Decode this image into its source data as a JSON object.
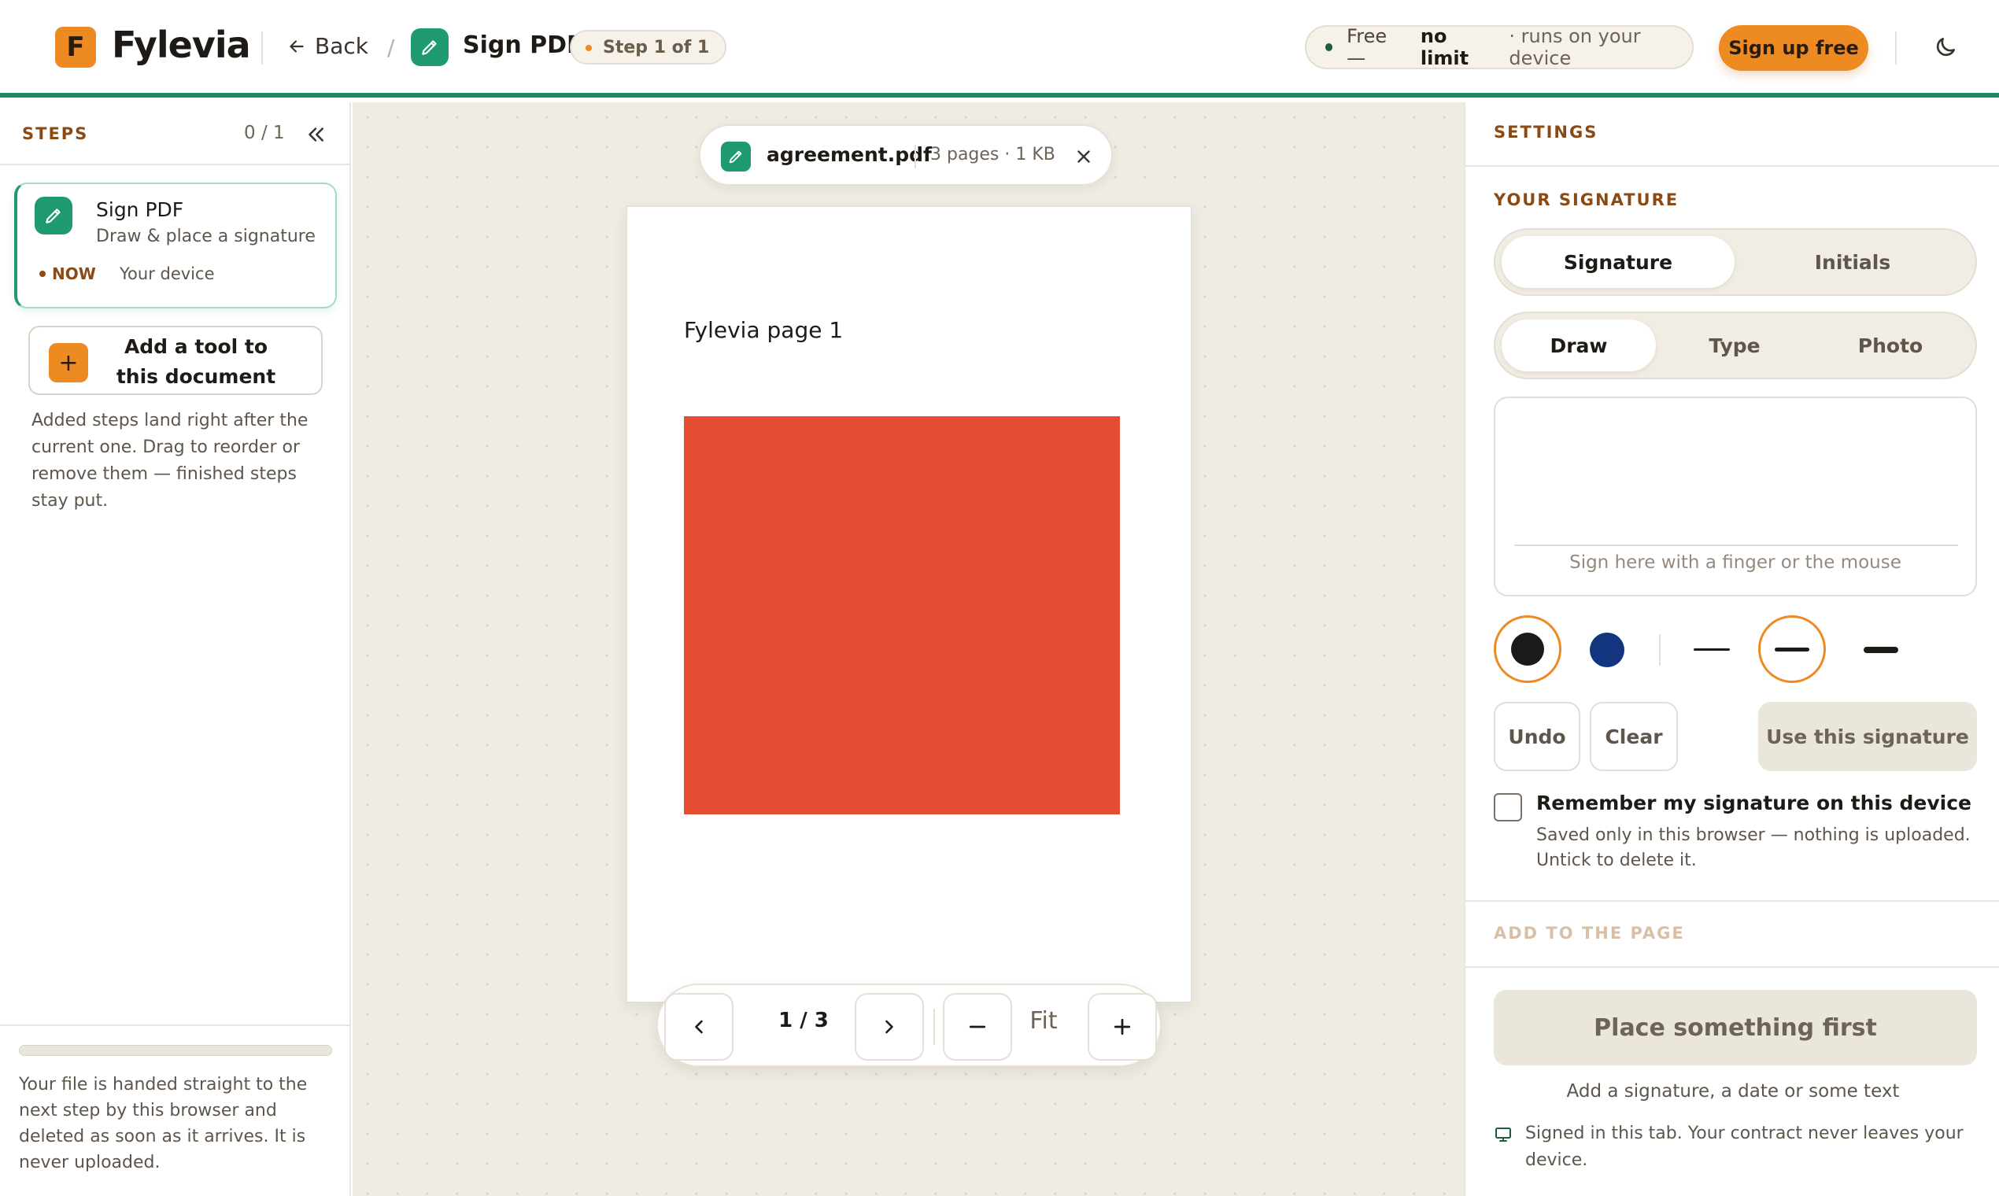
{
  "header": {
    "logo_letter": "F",
    "brand": "Fylevia",
    "back_label": "Back",
    "separator": "/",
    "tool_name": "Sign PDF",
    "step_badge": "Step 1 of 1",
    "free_prefix": "Free —",
    "free_bold": "no limit",
    "free_suffix": "· runs on your device",
    "signup_label": "Sign up free"
  },
  "steps_panel": {
    "heading": "STEPS",
    "count": "0 / 1",
    "step": {
      "title": "Sign PDF",
      "subtitle": "Draw & place a signature",
      "status": "NOW",
      "location": "Your device"
    },
    "add_tool_label": "Add a tool to this document",
    "add_tool_symbol": "+",
    "help_text": "Added steps land right after the current one. Drag to reorder or remove them — finished steps stay put.",
    "progress": 0,
    "file_note": "Your file is handed straight to the next step by this browser and deleted as soon as it arrives. It is never uploaded."
  },
  "document": {
    "filename": "agreement.pdf",
    "meta": "3 pages · 1 KB",
    "page_title": "Fylevia page 1",
    "page_indicator": "1 / 3",
    "fit_label": "Fit",
    "red_box_color": "#e54c32"
  },
  "settings": {
    "heading": "SETTINGS",
    "your_signature": "YOUR SIGNATURE",
    "kind_tabs": [
      "Signature",
      "Initials"
    ],
    "kind_active": 0,
    "mode_tabs": [
      "Draw",
      "Type",
      "Photo"
    ],
    "mode_active": 0,
    "pad_hint": "Sign here with a finger or the mouse",
    "colors": [
      "#1a1a1a",
      "#13357f"
    ],
    "undo_label": "Undo",
    "clear_label": "Clear",
    "use_label": "Use this signature",
    "remember_label": "Remember my signature on this device",
    "remember_sub": "Saved only in this browser — nothing is uploaded. Untick to delete it.",
    "add_to_page": "ADD TO THE PAGE",
    "place_label": "Place something first",
    "place_sub": "Add a signature, a date or some text",
    "tab_note": "Signed in this tab. Your contract never leaves your device."
  },
  "theme": {
    "accent": "#ee8a22",
    "brand_green": "#1f9a6e",
    "label_brown": "#8b4a14"
  }
}
